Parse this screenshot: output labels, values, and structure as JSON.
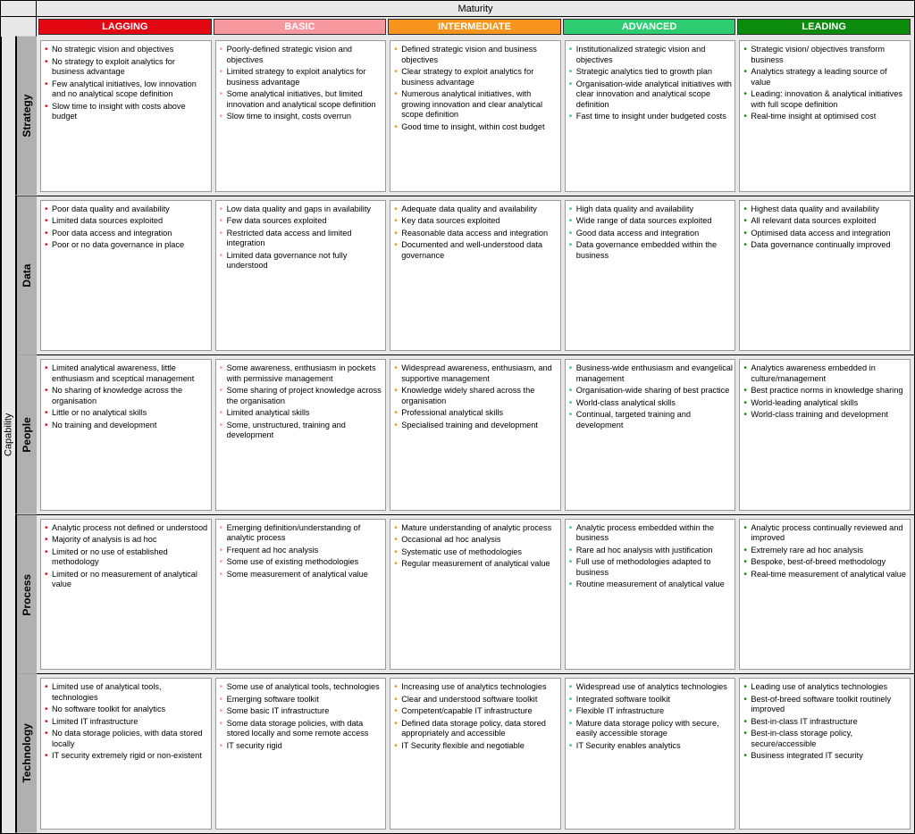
{
  "header": {
    "top_label": "Maturity",
    "side_label": "Capability",
    "levels": [
      {
        "name": "LAGGING",
        "color": "#e30613"
      },
      {
        "name": "BASIC",
        "color": "#f6989d"
      },
      {
        "name": "INTERMEDIATE",
        "color": "#f7941e"
      },
      {
        "name": "ADVANCED",
        "color": "#2ecc71"
      },
      {
        "name": "LEADING",
        "color": "#0b8a0b"
      }
    ]
  },
  "bullet_colors": [
    "#e30613",
    "#f6989d",
    "#f7941e",
    "#2ecc71",
    "#0b8a0b"
  ],
  "capabilities": [
    {
      "name": "Strategy",
      "levels": [
        [
          "No strategic vision and objectives",
          "No strategy to exploit analytics for business advantage",
          "Few analytical initiatives, low innovation and no analytical scope definition",
          "Slow time to insight with costs above budget"
        ],
        [
          "Poorly-defined strategic vision and objectives",
          "Limited strategy to exploit analytics for business advantage",
          "Some analytical initiatives, but limited innovation and analytical scope definition",
          "Slow time to insight, costs overrun"
        ],
        [
          "Defined strategic vision and business objectives",
          "Clear strategy to exploit analytics for business advantage",
          "Numerous analytical initiatives, with growing innovation and clear analytical scope definition",
          "Good time to insight, within cost budget"
        ],
        [
          "Institutionalized strategic vision and objectives",
          "Strategic analytics tied to growth plan",
          "Organisation-wide analytical initiatives with clear innovation and analytical scope definition",
          "Fast time to insight under budgeted costs"
        ],
        [
          "Strategic vision/ objectives transform business",
          "Analytics strategy a leading source of value",
          "Leading: innovation & analytical initiatives with full scope definition",
          "Real-time insight at optimised cost"
        ]
      ]
    },
    {
      "name": "Data",
      "levels": [
        [
          "Poor data quality and availability",
          "Limited data sources exploited",
          "Poor data access and integration",
          "Poor or no data governance in place"
        ],
        [
          "Low data quality and gaps in availability",
          "Few data sources exploited",
          "Restricted data access and limited integration",
          "Limited data governance not fully understood"
        ],
        [
          "Adequate data quality and availability",
          "Key data sources exploited",
          "Reasonable data access and integration",
          "Documented and well-understood data governance"
        ],
        [
          "High data quality and availability",
          "Wide range of data sources exploited",
          "Good data access and integration",
          "Data governance embedded within the business"
        ],
        [
          "Highest data quality and availability",
          "All relevant data sources exploited",
          "Optimised data access and integration",
          "Data governance continually improved"
        ]
      ]
    },
    {
      "name": "People",
      "levels": [
        [
          "Limited analytical awareness, little enthusiasm and sceptical management",
          "No sharing of knowledge across the organisation",
          "Little or no analytical skills",
          "No training and development"
        ],
        [
          "Some awareness, enthusiasm in pockets with permissive management",
          "Some sharing of project knowledge across the organisation",
          "Limited analytical skills",
          "Some, unstructured, training and development"
        ],
        [
          "Widespread awareness, enthusiasm, and supportive management",
          "Knowledge widely shared across the organisation",
          "Professional analytical skills",
          "Specialised training and development"
        ],
        [
          "Business-wide enthusiasm and evangelical management",
          "Organisation-wide sharing of best practice",
          "World-class analytical skills",
          "Continual, targeted training and development"
        ],
        [
          "Analytics awareness embedded in culture/management",
          "Best practice norms in knowledge sharing",
          "World-leading analytical skills",
          "World-class training and development"
        ]
      ]
    },
    {
      "name": "Process",
      "levels": [
        [
          "Analytic process not defined or understood",
          "Majority of analysis is ad hoc",
          "Limited or no use of established methodology",
          "Limited or no measurement of analytical value"
        ],
        [
          "Emerging definition/understanding of analytic process",
          "Frequent ad hoc analysis",
          "Some use of existing methodologies",
          "Some measurement of analytical value"
        ],
        [
          "Mature understanding of analytic process",
          "Occasional ad hoc analysis",
          "Systematic use of methodologies",
          "Regular measurement of analytical value"
        ],
        [
          "Analytic process embedded within the business",
          "Rare ad hoc analysis with justification",
          "Full use of methodologies adapted to business",
          "Routine measurement of analytical value"
        ],
        [
          "Analytic process continually reviewed and improved",
          "Extremely rare ad hoc analysis",
          "Bespoke, best-of-breed methodology",
          "Real-time measurement of analytical value"
        ]
      ]
    },
    {
      "name": "Technology",
      "levels": [
        [
          "Limited use of analytical tools, technologies",
          "No software toolkit for analytics",
          "Limited IT infrastructure",
          "No data storage policies, with data stored locally",
          "IT security extremely rigid or non-existent"
        ],
        [
          "Some use of analytical tools, technologies",
          "Emerging software toolkit",
          "Some basic IT infrastructure",
          "Some data storage policies, with data stored locally and some remote access",
          "IT security rigid"
        ],
        [
          "Increasing use of analytics technologies",
          "Clear and understood software toolkit",
          "Competent/capable IT infrastructure",
          "Defined data storage policy, data stored appropriately and accessible",
          "IT Security flexible and negotiable"
        ],
        [
          "Widespread use of analytics technologies",
          "Integrated software toolkit",
          "Flexible IT infrastructure",
          "Mature data storage policy with secure, easily accessible storage",
          "IT Security enables analytics"
        ],
        [
          "Leading use of analytics technologies",
          "Best-of-breed software toolkit routinely improved",
          "Best-in-class IT infrastructure",
          "Best-in-class storage policy, secure/accessible",
          "Business integrated IT security"
        ]
      ]
    }
  ]
}
